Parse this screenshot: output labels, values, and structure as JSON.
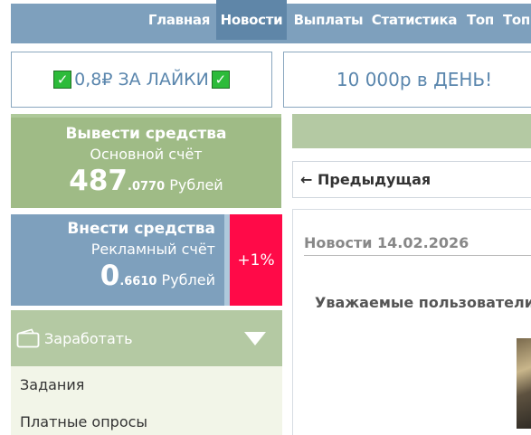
{
  "nav": {
    "items": [
      {
        "label": "Главная"
      },
      {
        "label": "Новости"
      },
      {
        "label": "Выплаты"
      },
      {
        "label": "Статистика"
      },
      {
        "label": "Топ"
      },
      {
        "label": "Топ"
      }
    ],
    "active": "Новости"
  },
  "promo": {
    "left_text": "0,8₽ ЗА ЛАЙКИ",
    "right_text": "10 000р в ДЕНЬ!"
  },
  "withdraw": {
    "title": "Вывести средства",
    "account": "Основной счёт",
    "amount_int": "487",
    "amount_frac": ".0770",
    "currency": "Рублей"
  },
  "deposit": {
    "title": "Внести средства",
    "account": "Рекламный счёт",
    "amount_int": "0",
    "amount_frac": ".6610",
    "currency": "Рублей",
    "bonus": "+1%"
  },
  "earn": {
    "label": "Заработать",
    "icon": "wallet-icon",
    "toggle_icon": "triangle-down-icon"
  },
  "menu": {
    "items": [
      {
        "label": "Задания"
      },
      {
        "label": "Платные опросы"
      }
    ]
  },
  "pager": {
    "prev_label": "← Предыдущая"
  },
  "news": {
    "date": "Новости 14.02.2026",
    "text": "Уважаемые пользователи"
  },
  "colors": {
    "nav_bg": "#7ea0bd",
    "nav_active": "#5f86a8",
    "green": "#9fbb86",
    "accent_red": "#ff0a48",
    "promo_text": "#5a86ad"
  }
}
